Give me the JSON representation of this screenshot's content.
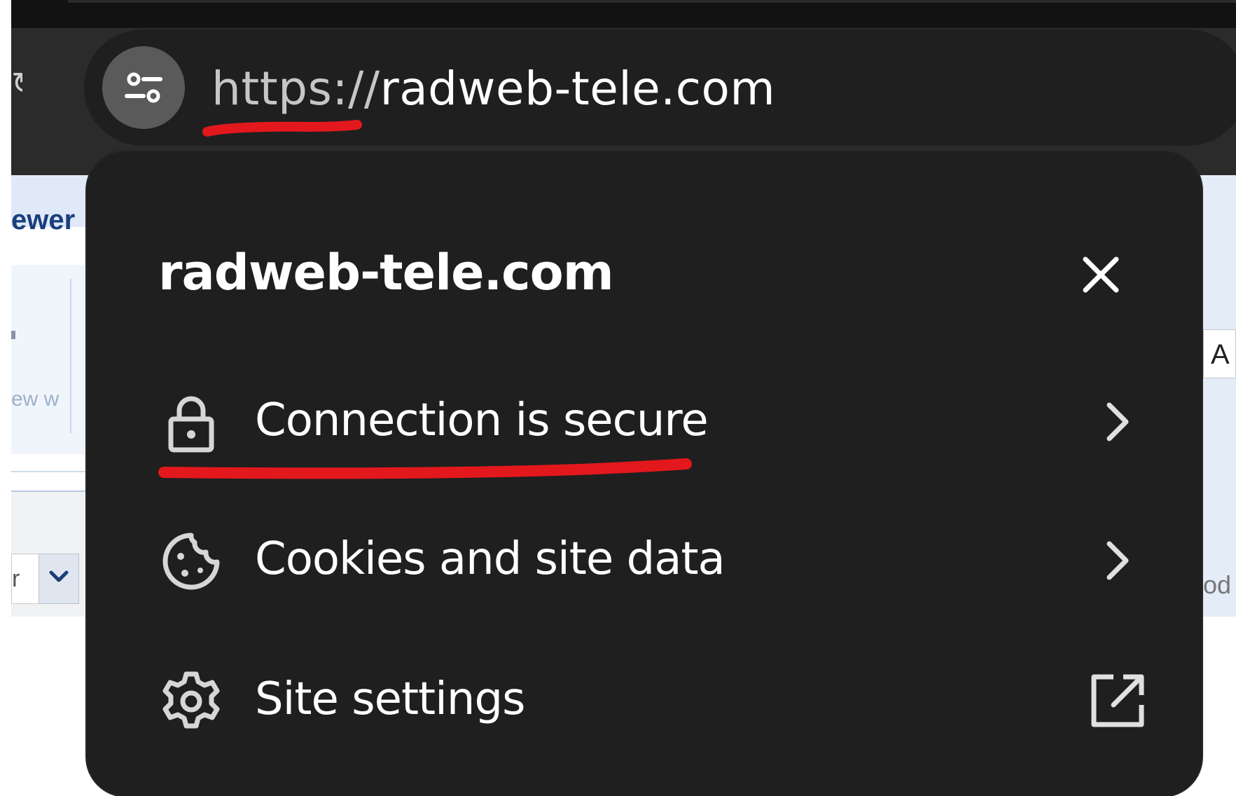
{
  "browser": {
    "address_bar": {
      "scheme": "https://",
      "host": "radweb-tele.com"
    }
  },
  "page_behind": {
    "section_label_fragment": "ewer",
    "faded_text_fragment": "ew w",
    "dropdown_value_fragment": "r",
    "right_field_fragment": "A",
    "right_text_fragment": "od"
  },
  "site_info_popup": {
    "title": "radweb-tele.com",
    "items": [
      {
        "label": "Connection is secure",
        "icon": "lock-icon",
        "trail_icon": "chevron-right-icon"
      },
      {
        "label": "Cookies and site data",
        "icon": "cookie-icon",
        "trail_icon": "chevron-right-icon"
      },
      {
        "label": "Site settings",
        "icon": "gear-icon",
        "trail_icon": "open-in-new-icon"
      }
    ]
  },
  "colors": {
    "chrome_bg": "#2b2b2b",
    "omnibox_bg": "#1f1f1f",
    "popup_bg": "#1f1f1f",
    "text": "#ffffff",
    "annotation_red": "#e3181d"
  }
}
